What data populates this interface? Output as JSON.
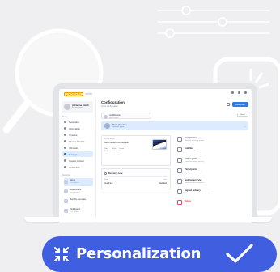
{
  "app": {
    "logo_brand": "PICKEDUP",
    "logo_sub": "seller",
    "page_title": "Configuration",
    "page_subtitle": "Team configuration",
    "primary_button": "New order",
    "right_button": "Reset"
  },
  "sidebar": {
    "profile_name": "Adrienne Smith",
    "profile_role": "Administrator",
    "section_label": "Menu",
    "items": [
      {
        "label": "Navigation"
      },
      {
        "label": "Information"
      },
      {
        "label": "Timeline"
      },
      {
        "label": "Diverse Models"
      },
      {
        "label": "Ultimately"
      },
      {
        "label": "Settings"
      },
      {
        "label": "Inspect content"
      },
      {
        "label": "Global Stat"
      }
    ],
    "section2_label": "Records",
    "subitems": [
      {
        "title": "Home",
        "sub": "Last updated"
      },
      {
        "title": "Analytics list",
        "sub": "Last reviewed"
      },
      {
        "title": "Monthly overview",
        "sub": "Last updated"
      },
      {
        "title": "Distributors",
        "sub": "Last updated"
      }
    ]
  },
  "main": {
    "chip_title": "modifications",
    "chip_sub": "adjust status",
    "selected_row_title": "Main objective",
    "selected_row_sub": "Updated today",
    "card_a": {
      "label": "Profile details",
      "value": "Seller added from request",
      "stats": [
        {
          "k": "Date",
          "v": "12/09"
        },
        {
          "k": "Stock",
          "v": "184"
        },
        {
          "k": "Pause",
          "v": "Yes"
        }
      ]
    },
    "card_b": {
      "title": "Delivery note",
      "left_label": "Mode",
      "left_value": "Automatic",
      "right_label": "Unit",
      "right_value": "Standard"
    },
    "list": [
      {
        "title": "Completion",
        "sub": "Workflow structure setting"
      },
      {
        "title": "Add file",
        "sub": "Upload any file type"
      },
      {
        "title": "Follow path",
        "sub": "Trace the delivery journey"
      },
      {
        "title": "Participants",
        "sub": "Give members access"
      },
      {
        "title": "Notification rule",
        "sub": "Send alert when complete"
      },
      {
        "title": "Signed delivery",
        "sub": "Adjust who needs to sign and approve"
      },
      {
        "title": "Delete",
        "sub": ""
      }
    ]
  },
  "pill": {
    "label": "Personalization",
    "color": "#3f5fe0"
  },
  "icons": {
    "pill_left": "collapse-arrows-icon",
    "pill_right": "checkmark-icon",
    "bg_search": "magnifier-icon",
    "bg_sliders": "sliders-icon"
  }
}
